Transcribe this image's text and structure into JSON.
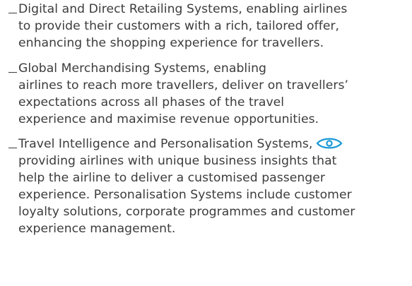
{
  "items": [
    {
      "lines": [
        "Digital and Direct Retailing Systems, enabling airlines",
        "to provide their customers with a rich, tailored offer,",
        "enhancing the shopping experience for travellers."
      ]
    },
    {
      "lines": [
        "Global Merchandising Systems, enabling",
        "airlines to reach more travellers, deliver on travellers’",
        "expectations across all phases of the travel",
        "experience and maximise revenue opportunities."
      ]
    },
    {
      "lines": [
        "Travel Intelligence and Personalisation Systems,",
        "providing airlines with unique business insights that",
        "help the airline to deliver a customised passenger",
        "experience. Personalisation Systems include customer",
        "loyalty solutions, corporate programmes and customer",
        "experience management."
      ],
      "icon": "eye-icon",
      "icon_color": "#1a9ad6"
    }
  ],
  "colors": {
    "text": "#3c3c3c",
    "accent": "#1a9ad6"
  }
}
